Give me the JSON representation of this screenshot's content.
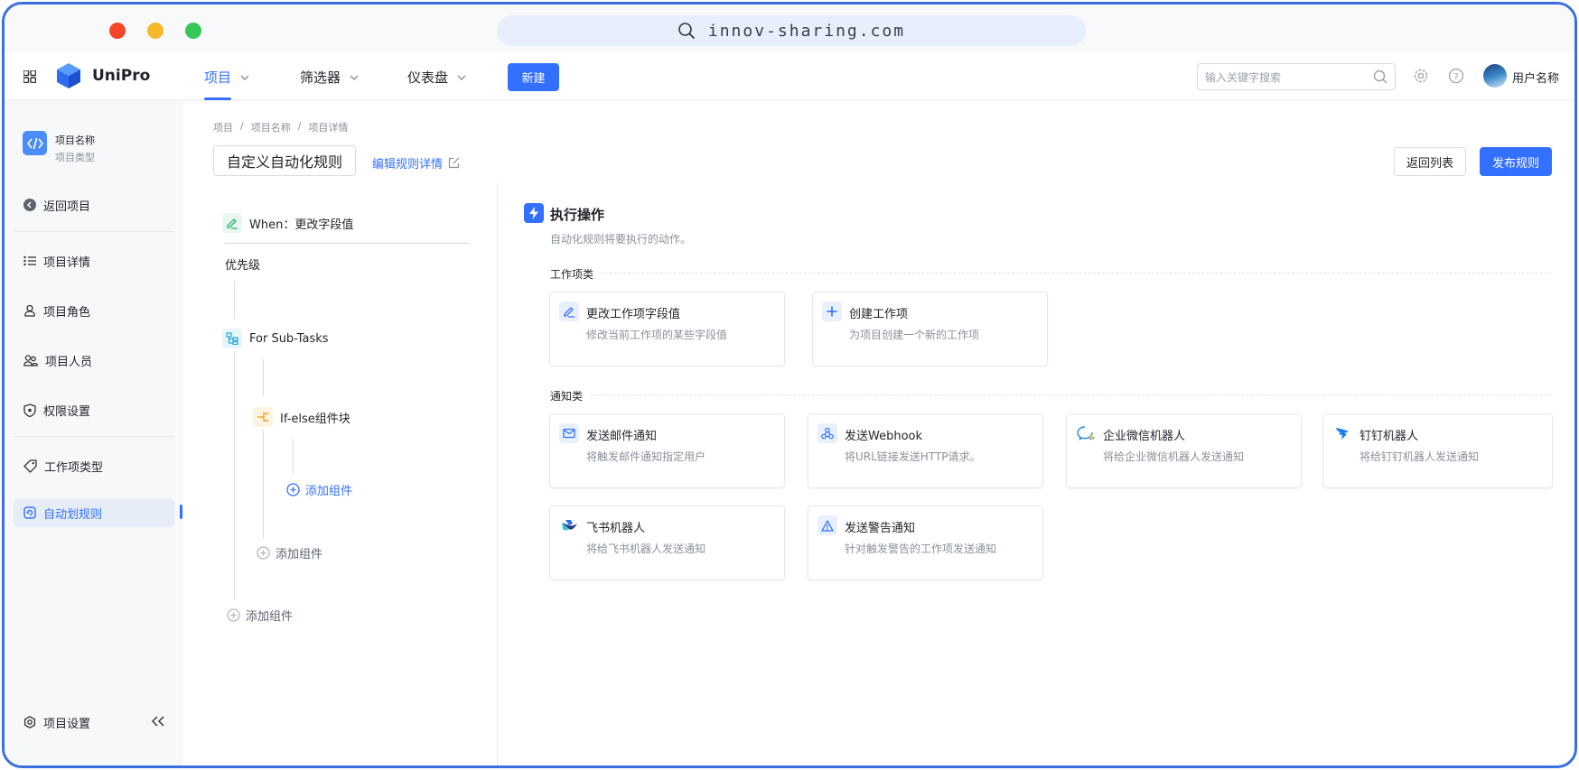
{
  "browser": {
    "url": "innov-sharing.com"
  },
  "header": {
    "brand": "UniPro",
    "nav": [
      {
        "label": "项目"
      },
      {
        "label": "筛选器"
      },
      {
        "label": "仪表盘"
      }
    ],
    "new_button": "新建",
    "search_placeholder": "输入关键字搜索",
    "username": "用户名称"
  },
  "sidebar": {
    "project_name": "项目名称",
    "project_type": "项目类型",
    "back": "返回项目",
    "items": [
      {
        "label": "项目详情"
      },
      {
        "label": "项目角色"
      },
      {
        "label": "项目人员"
      },
      {
        "label": "权限设置"
      },
      {
        "label": "工作项类型"
      },
      {
        "label": "自动划规则"
      }
    ],
    "settings": "项目设置"
  },
  "breadcrumb": [
    "项目",
    "项目名称",
    "项目详情"
  ],
  "page": {
    "rule_title": "自定义自动化规则",
    "edit_link": "编辑规则详情",
    "back_button": "返回列表",
    "publish_button": "发布规则"
  },
  "flow": {
    "trigger": "When：更改字段值",
    "priority": "优先级",
    "branch": "For Sub-Tasks",
    "condition": "If-else组件块",
    "add_inner": "添加组件",
    "add_middle": "添加组件",
    "add_outer": "添加组件"
  },
  "actions": {
    "title": "执行操作",
    "subtitle": "自动化规则将要执行的动作。",
    "work_section": "工作项类",
    "work_cards": [
      {
        "title": "更改工作项字段值",
        "desc": "修改当前工作项的某些字段值",
        "icon": "edit-icon"
      },
      {
        "title": "创建工作项",
        "desc": "为项目创建一个新的工作项",
        "icon": "plus-icon"
      }
    ],
    "notify_section": "通知类",
    "notify_cards": [
      {
        "title": "发送邮件通知",
        "desc": "将触发邮件通知指定用户",
        "icon": "mail-icon"
      },
      {
        "title": "发送Webhook",
        "desc": "将URL链接发送HTTP请求。",
        "icon": "webhook-icon"
      },
      {
        "title": "企业微信机器人",
        "desc": "将给企业微信机器人发送通知",
        "icon": "wecom-icon"
      },
      {
        "title": "钉钉机器人",
        "desc": "将给钉钉机器人发送通知",
        "icon": "dingtalk-icon"
      },
      {
        "title": "飞书机器人",
        "desc": "将给飞书机器人发送通知",
        "icon": "feishu-icon"
      },
      {
        "title": "发送警告通知",
        "desc": "针对触发警告的工作项发送通知",
        "icon": "warning-icon"
      }
    ]
  },
  "colors": {
    "accent": "#3370ff",
    "sidebar_bg": "#f7f8fa",
    "frame": "#3b6fe0"
  }
}
